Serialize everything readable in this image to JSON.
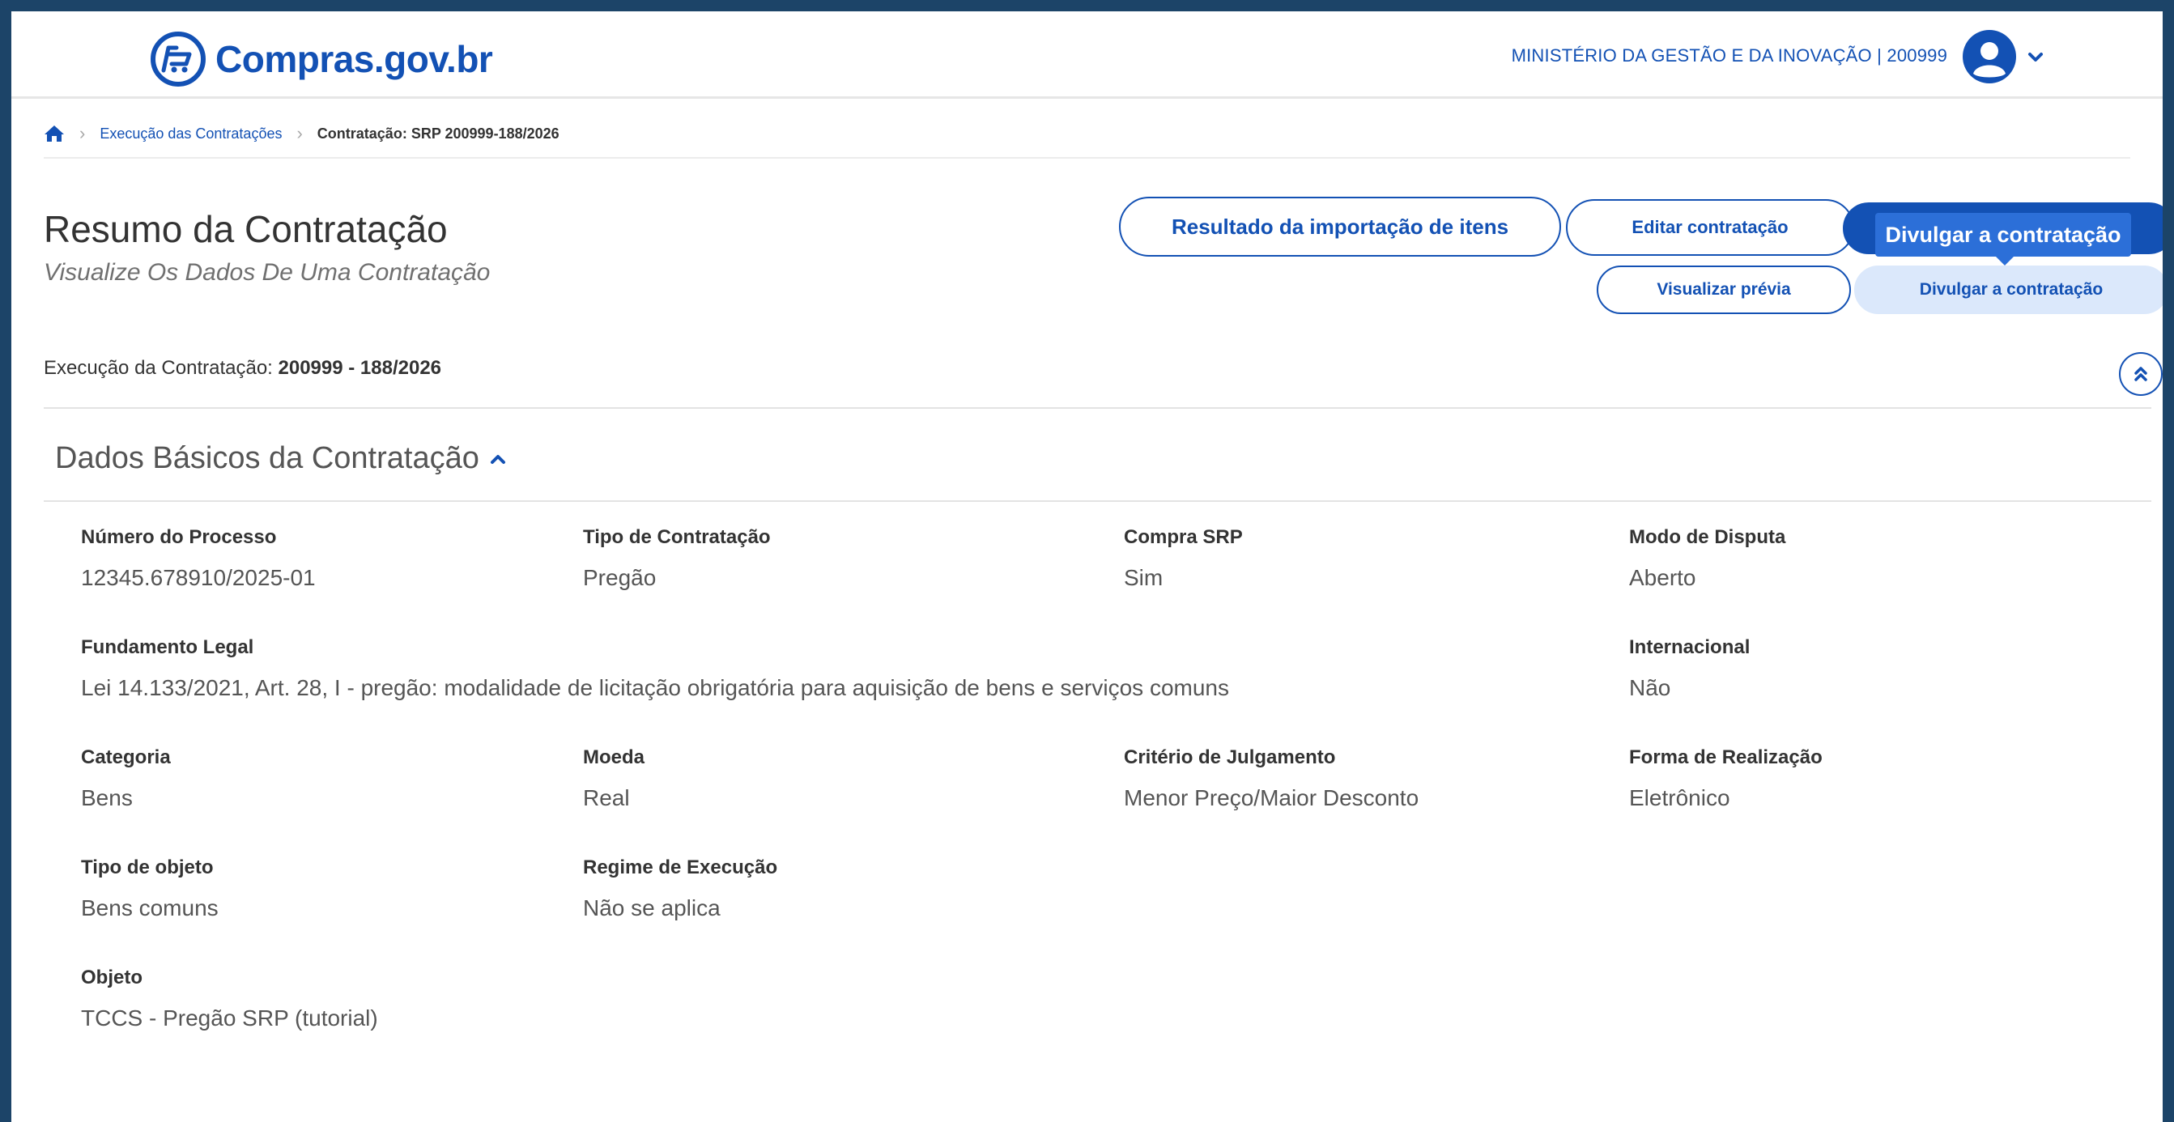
{
  "header": {
    "logo_text": "Compras",
    "logo_tld": ".gov.br",
    "org_label": "MINISTÉRIO DA GESTÃO E DA INOVAÇÃO | 200999",
    "brand_color": "#1351b4"
  },
  "breadcrumb": {
    "items": [
      "Execução das Contratações",
      "Contratação: SRP 200999-188/2026"
    ]
  },
  "page": {
    "title": "Resumo da Contratação",
    "subtitle": "Visualize Os Dados De Uma Contratação"
  },
  "actions": {
    "import_result": "Resultado da importação de itens",
    "edit": "Editar contratação",
    "publish_tooltip": "Divulgar a contratação",
    "preview": "Visualizar prévia",
    "publish": "Divulgar a contratação"
  },
  "execution": {
    "label": "Execução da Contratação:",
    "value": "200999 - 188/2026"
  },
  "section": {
    "title": "Dados Básicos da Contratação"
  },
  "fields": {
    "numero_processo": {
      "label": "Número do Processo",
      "value": "12345.678910/2025-01"
    },
    "tipo_contratacao": {
      "label": "Tipo de Contratação",
      "value": "Pregão"
    },
    "compra_srp": {
      "label": "Compra SRP",
      "value": "Sim"
    },
    "modo_disputa": {
      "label": "Modo de Disputa",
      "value": "Aberto"
    },
    "fundamento_legal": {
      "label": "Fundamento Legal",
      "value": "Lei 14.133/2021, Art. 28, I - pregão: modalidade de licitação obrigatória para aquisição de bens e serviços comuns"
    },
    "internacional": {
      "label": "Internacional",
      "value": "Não"
    },
    "categoria": {
      "label": "Categoria",
      "value": "Bens"
    },
    "moeda": {
      "label": "Moeda",
      "value": "Real"
    },
    "criterio_julgamento": {
      "label": "Critério de Julgamento",
      "value": "Menor Preço/Maior Desconto"
    },
    "forma_realizacao": {
      "label": "Forma de Realização",
      "value": "Eletrônico"
    },
    "tipo_objeto": {
      "label": "Tipo de objeto",
      "value": "Bens comuns"
    },
    "regime_execucao": {
      "label": "Regime de Execução",
      "value": "Não se aplica"
    },
    "objeto": {
      "label": "Objeto",
      "value": "TCCS - Pregão SRP (tutorial)"
    }
  }
}
